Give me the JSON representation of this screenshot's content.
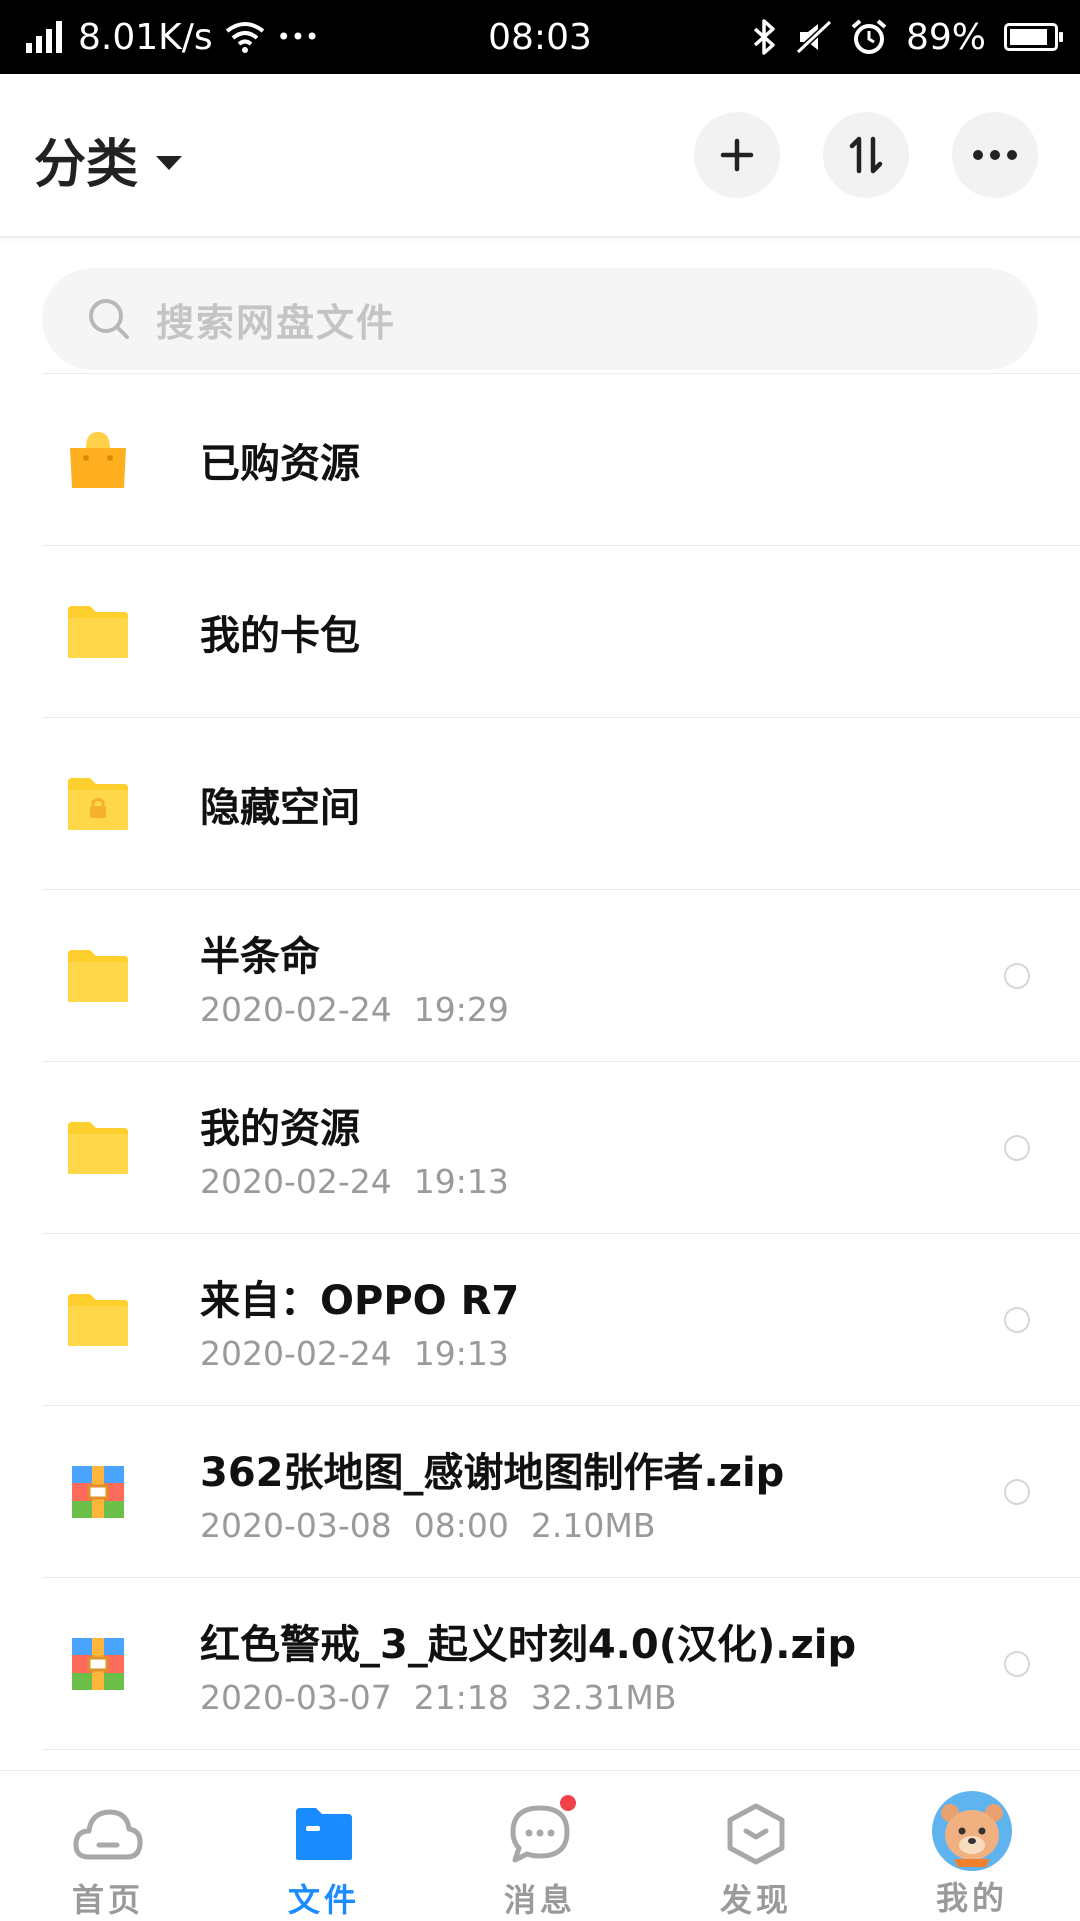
{
  "status_bar": {
    "net_speed": "8.01K/s",
    "more": "•••",
    "time": "08:03",
    "battery": "89%",
    "battery_level": 0.89
  },
  "header": {
    "title": "分类",
    "add_icon": "plus-icon",
    "sort_icon": "sort-icon",
    "more_icon": "more-icon"
  },
  "search": {
    "placeholder": "搜索网盘文件"
  },
  "files": [
    {
      "icon": "shopping-bag-icon",
      "title": "已购资源"
    },
    {
      "icon": "folder-icon",
      "title": "我的卡包"
    },
    {
      "icon": "locked-folder-icon",
      "title": "隐藏空间"
    },
    {
      "icon": "folder-icon",
      "title": "半条命",
      "date": "2020-02-24",
      "time": "19:29",
      "size": ""
    },
    {
      "icon": "folder-icon",
      "title": "我的资源",
      "date": "2020-02-24",
      "time": "19:13",
      "size": ""
    },
    {
      "icon": "folder-icon",
      "title": "来自：OPPO R7",
      "date": "2020-02-24",
      "time": "19:13",
      "size": ""
    },
    {
      "icon": "zip-icon",
      "title": "362张地图_感谢地图制作者.zip",
      "date": "2020-03-08",
      "time": "08:00",
      "size": "2.10MB"
    },
    {
      "icon": "zip-icon",
      "title": "红色警戒_3_起义时刻4.0(汉化).zip",
      "date": "2020-03-07",
      "time": "21:18",
      "size": "32.31MB"
    }
  ],
  "bottom_nav": {
    "items": [
      {
        "label": "首页",
        "icon": "cloud-icon"
      },
      {
        "label": "文件",
        "icon": "file-folder-icon"
      },
      {
        "label": "消息",
        "icon": "chat-icon"
      },
      {
        "label": "发现",
        "icon": "discover-icon"
      },
      {
        "label": "我的",
        "icon": "avatar-icon"
      }
    ],
    "active_color": "#1a8cff",
    "inactive_color": "#9a9a9a"
  }
}
